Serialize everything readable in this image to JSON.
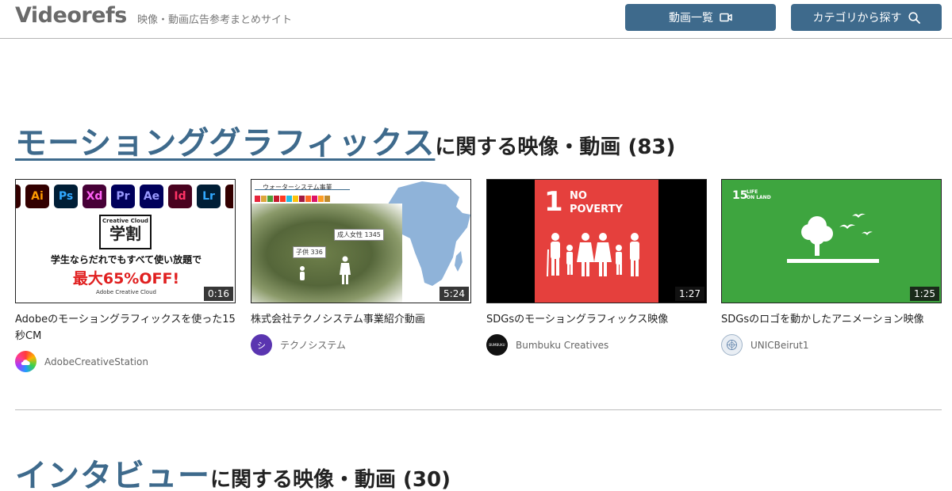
{
  "header": {
    "logo": "Videorefs",
    "tagline": "映像・動画広告参考まとめサイト",
    "videos_button": "動画一覧",
    "categories_button": "カテゴリから探す"
  },
  "sections": [
    {
      "category": "モーションググラフィックス",
      "suffix": "に関する映像・動画 (83)",
      "videos": [
        {
          "title": "Adobeのモーショングラフィックスを使った15秒CM",
          "duration": "0:16",
          "channel": "AdobeCreativeStation",
          "thumb": {
            "apps": [
              "Ai",
              "Ps",
              "Xd",
              "Pr",
              "Ae",
              "Id",
              "Lr"
            ],
            "badge_small": "Creative Cloud",
            "badge_big": "学割",
            "line1": "学生ならだれでもすべて使い放題で",
            "line2": "最大65%OFF!",
            "line3": "Adobe Creative Cloud"
          }
        },
        {
          "title": "株式会社テクノシステム事業紹介動画",
          "duration": "5:24",
          "channel": "テクノシステム",
          "avatar_text": "シ",
          "thumb": {
            "label": "ウォーターシステム事業",
            "bubble1": "成人女性 1345",
            "bubble2": "子供 336"
          }
        },
        {
          "title": "SDGsのモーショングラフィックス映像",
          "duration": "1:27",
          "channel": "Bumbuku Creatives",
          "avatar_text": "BUMBUKU",
          "thumb": {
            "number": "1",
            "text_line1": "NO",
            "text_line2": "POVERTY"
          }
        },
        {
          "title": "SDGsのロゴを動かしたアニメーション映像",
          "duration": "1:25",
          "channel": "UNICBeirut1",
          "thumb": {
            "number": "15",
            "text_line1": "LIFE",
            "text_line2": "ON LAND"
          }
        }
      ]
    },
    {
      "category": "インタビュー",
      "suffix": "に関する映像・動画 (30)"
    }
  ],
  "colors": {
    "accent": "#3e6a8c",
    "sdg1": "#e5403d",
    "sdg15": "#3ea53f"
  }
}
